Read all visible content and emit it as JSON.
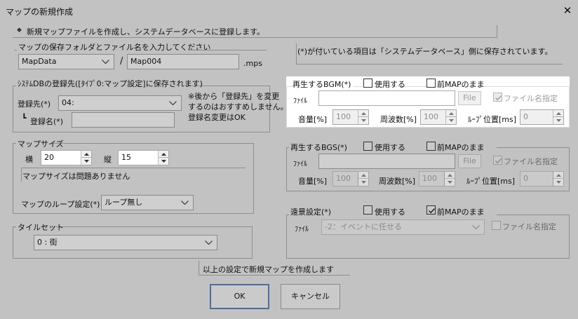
{
  "window": {
    "title": "マップの新規作成",
    "close_glyph": "✕"
  },
  "info": {
    "bullet": "◆",
    "text": "新規マップファイルを作成し、システムデータベースに登録します。"
  },
  "save": {
    "label": "マップの保存フォルダとファイル名を入力してください",
    "folder": "MapData",
    "slash": "/",
    "filename": "Map004",
    "ext": ".mps"
  },
  "db": {
    "label": "ｼｽﾃﾑDBの登録先([ﾀｲﾌﾟ0:マップ設定]に保存されます)",
    "dest_label": "登録先(*)",
    "dest_value": "04:",
    "name_prefix": "┗",
    "name_label": "登録名(*)",
    "name_value": "",
    "note_line1": "※後から「登録先」を変更",
    "note_line2": "するのはおすすめしません。",
    "note_line3": "登録名変更はOK"
  },
  "size": {
    "label": "マップサイズ",
    "w_label": "横",
    "w_value": "20",
    "h_label": "縦",
    "h_value": "15",
    "note": "マップサイズは問題ありません",
    "loop_label": "マップのループ設定(*)",
    "loop_value": "ループ無し"
  },
  "tileset": {
    "label": "タイルセット",
    "value": "0 : 街"
  },
  "notice": "(*)が付いている項目は「システムデータベース」側に保存されています。",
  "bgm": {
    "title": "再生するBGM(*)",
    "use_label": "使用する",
    "prev_label": "前MAPのまま",
    "file_label": "ﾌｧｲﾙ",
    "file_value": "",
    "file_button": "File",
    "name_label": "ファイル名指定",
    "vol_label": "音量[%]",
    "vol_value": "100",
    "freq_label": "周波数[%]",
    "freq_value": "100",
    "loop_label": "ﾙｰﾌﾟ位置[ms]",
    "loop_value": "0"
  },
  "bgs": {
    "title": "再生するBGS(*)",
    "use_label": "使用する",
    "prev_label": "前MAPのまま",
    "file_label": "ﾌｧｲﾙ",
    "file_value": "",
    "file_button": "File",
    "name_label": "ファイル名指定",
    "vol_label": "音量[%]",
    "vol_value": "100",
    "freq_label": "周波数[%]",
    "freq_value": "100",
    "loop_label": "ﾙｰﾌﾟ位置[ms]",
    "loop_value": "0"
  },
  "bg": {
    "title": "遠景設定(*)",
    "use_label": "使用する",
    "prev_label": "前MAPのまま",
    "file_label": "ﾌｧｲﾙ",
    "file_value": "-2：イベントに任せる",
    "name_label": "ファイル名指定"
  },
  "footer": {
    "message": "以上の設定で新規マップを作成します",
    "ok": "OK",
    "cancel": "キャンセル"
  },
  "colors": {
    "dialog_bg": "#c2c2c2",
    "highlight_bg": "#ffffff",
    "ok_border": "#4a6f9e"
  }
}
